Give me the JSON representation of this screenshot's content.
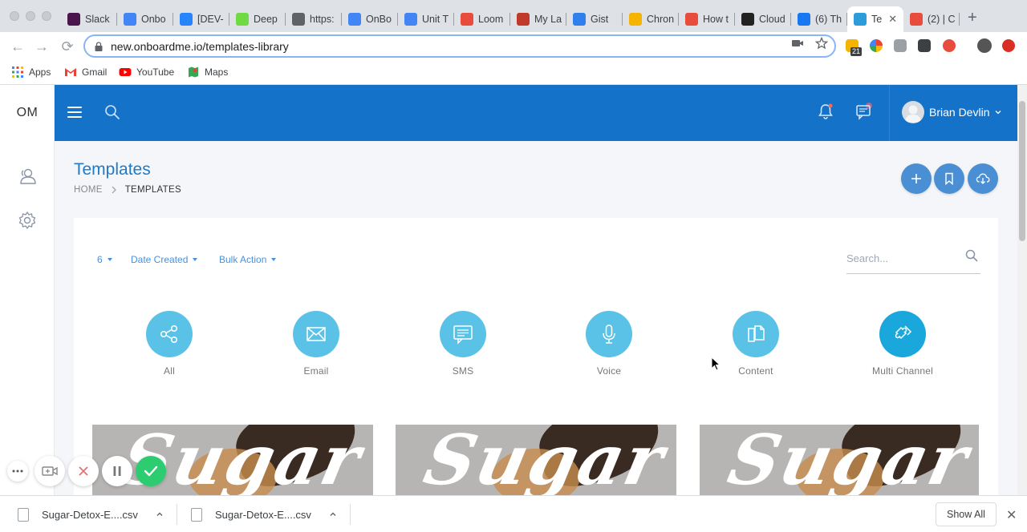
{
  "browser": {
    "tabs": [
      {
        "label": "Slack",
        "color": "#4a154b"
      },
      {
        "label": "Onbo",
        "color": "#4285f4"
      },
      {
        "label": "[DEV-",
        "color": "#2684ff"
      },
      {
        "label": "Deep",
        "color": "#6fda44"
      },
      {
        "label": "https:",
        "color": "#5f6368"
      },
      {
        "label": "OnBo",
        "color": "#4285f4"
      },
      {
        "label": "Unit T",
        "color": "#4285f4"
      },
      {
        "label": "Loom",
        "color": "#e74c3c"
      },
      {
        "label": "My La",
        "color": "#c0392b"
      },
      {
        "label": "Gist",
        "color": "#2f80ed"
      },
      {
        "label": "Chron",
        "color": "#f4b400"
      },
      {
        "label": "How t",
        "color": "#e74c3c"
      },
      {
        "label": "Cloud",
        "color": "#222222"
      },
      {
        "label": "(6) Th",
        "color": "#1877f2"
      },
      {
        "label": "Te",
        "color": "#2d9cdb"
      },
      {
        "label": "(2) | C",
        "color": "#e74c3c"
      }
    ],
    "active_tab_index": 14,
    "url": "new.onboardme.io/templates-library",
    "extension_badge": "21",
    "bookmarks": [
      {
        "label": "Apps"
      },
      {
        "label": "Gmail"
      },
      {
        "label": "YouTube"
      },
      {
        "label": "Maps"
      }
    ]
  },
  "app": {
    "logo": "OM",
    "user_name": "Brian Devlin",
    "page_title": "Templates",
    "breadcrumb": {
      "home": "HOME",
      "current": "TEMPLATES"
    },
    "filters": {
      "page_size": "6",
      "sort": "Date Created",
      "bulk": "Bulk Action"
    },
    "search_placeholder": "Search...",
    "categories": [
      {
        "label": "All",
        "icon": "share-icon"
      },
      {
        "label": "Email",
        "icon": "envelope-icon"
      },
      {
        "label": "SMS",
        "icon": "message-icon"
      },
      {
        "label": "Voice",
        "icon": "microphone-icon"
      },
      {
        "label": "Content",
        "icon": "documents-icon"
      },
      {
        "label": "Multi Channel",
        "icon": "puzzle-icon"
      }
    ],
    "card_script_text": "Sugar",
    "colors": {
      "primary": "#1572c9",
      "accent": "#5bc2e7",
      "title": "#1f7ac7",
      "fab": "#4a8fd3"
    }
  },
  "downloads": {
    "items": [
      {
        "name": "Sugar-Detox-E....csv"
      },
      {
        "name": "Sugar-Detox-E....csv"
      }
    ],
    "show_all": "Show All"
  }
}
